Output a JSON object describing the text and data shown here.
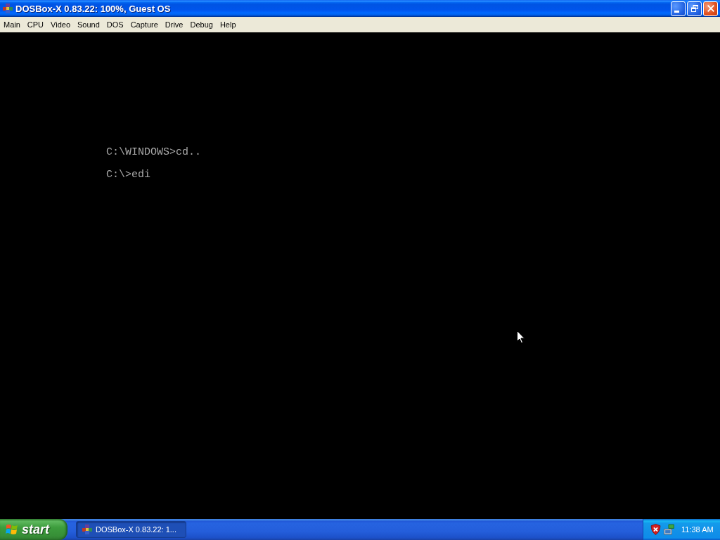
{
  "window": {
    "title": "DOSBox-X 0.83.22: 100%, Guest OS"
  },
  "menu_bar": [
    "Main",
    "CPU",
    "Video",
    "Sound",
    "DOS",
    "Capture",
    "Drive",
    "Debug",
    "Help"
  ],
  "console": {
    "lines": [
      "C:\\WINDOWS>cd..",
      "C:\\>edi"
    ]
  },
  "taskbar": {
    "start_label": "start",
    "tasks": [
      {
        "label": "DOSBox-X 0.83.22: 1...",
        "selected": true
      }
    ],
    "clock": "11:38 AM"
  }
}
